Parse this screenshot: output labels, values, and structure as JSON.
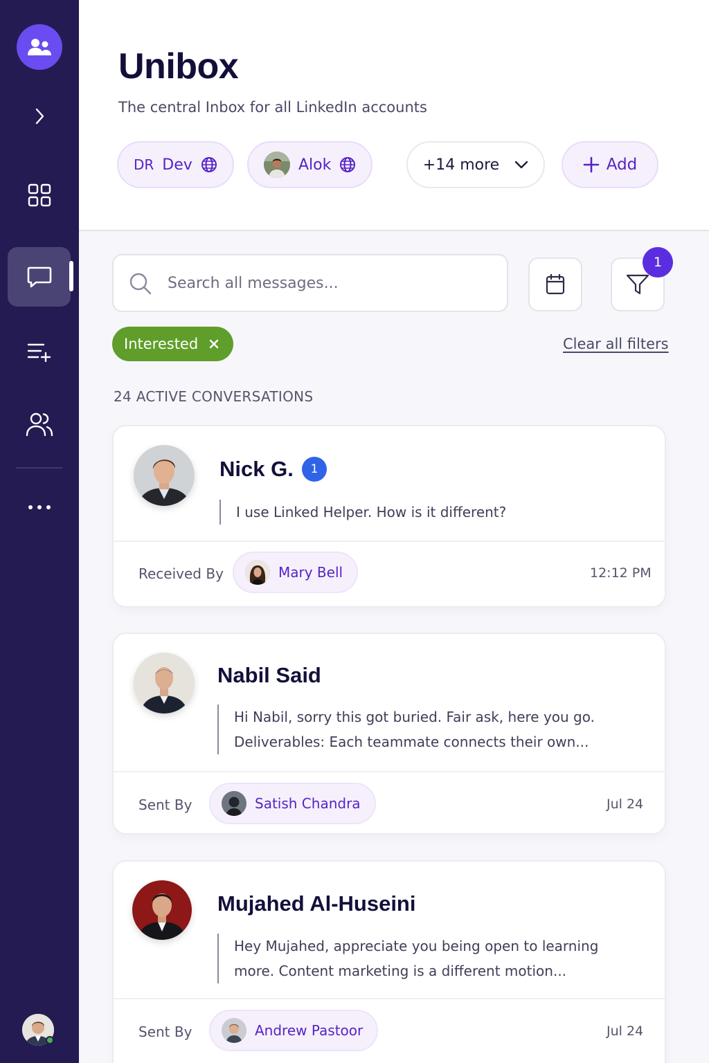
{
  "sidebar": {
    "logo_icon": "team-icon",
    "items": [
      {
        "name": "expand",
        "icon": "chevron-right-icon"
      },
      {
        "name": "dashboard",
        "icon": "grid-icon"
      },
      {
        "name": "messages",
        "icon": "chat-icon",
        "active": true
      },
      {
        "name": "lists",
        "icon": "list-add-icon"
      },
      {
        "name": "contacts",
        "icon": "users-icon"
      },
      {
        "name": "more",
        "icon": "more-horizontal-icon"
      }
    ],
    "status": "online"
  },
  "header": {
    "title": "Unibox",
    "subtitle": "The central Inbox for all LinkedIn accounts"
  },
  "accounts": [
    {
      "initials": "DR",
      "name": "Dev",
      "icon": "globe-icon"
    },
    {
      "name": "Alok",
      "icon": "globe-icon"
    }
  ],
  "more_accounts": "+14 more",
  "add_label": "Add",
  "search": {
    "placeholder": "Search all messages..."
  },
  "filter_count": "1",
  "active_filter": "Interested",
  "clear_filters": "Clear all filters",
  "conversation_count": "24 ACTIVE CONVERSATIONS",
  "conversations": [
    {
      "name": "Nick G.",
      "unread": "1",
      "preview_lines": [
        "I use Linked Helper. How is it different?"
      ],
      "footer_label": "Received By",
      "agent": "Mary Bell",
      "time": "12:12 PM"
    },
    {
      "name": "Nabil Said",
      "preview_lines": [
        "Hi Nabil, sorry this got buried. Fair ask, here you go.",
        "Deliverables: Each teammate connects their own..."
      ],
      "footer_label": "Sent By",
      "agent": "Satish Chandra",
      "time": "Jul 24"
    },
    {
      "name": "Mujahed Al-Huseini",
      "preview_lines": [
        "Hey Mujahed, appreciate you being open to learning",
        "more. Content marketing is a different motion..."
      ],
      "footer_label": "Sent By",
      "agent": "Andrew Pastoor",
      "time": "Jul 24"
    }
  ],
  "colors": {
    "sidebar": "#231b52",
    "accent": "#5523c4",
    "interested_tag": "#5f9e2a",
    "unread_badge": "#2f64e8"
  }
}
